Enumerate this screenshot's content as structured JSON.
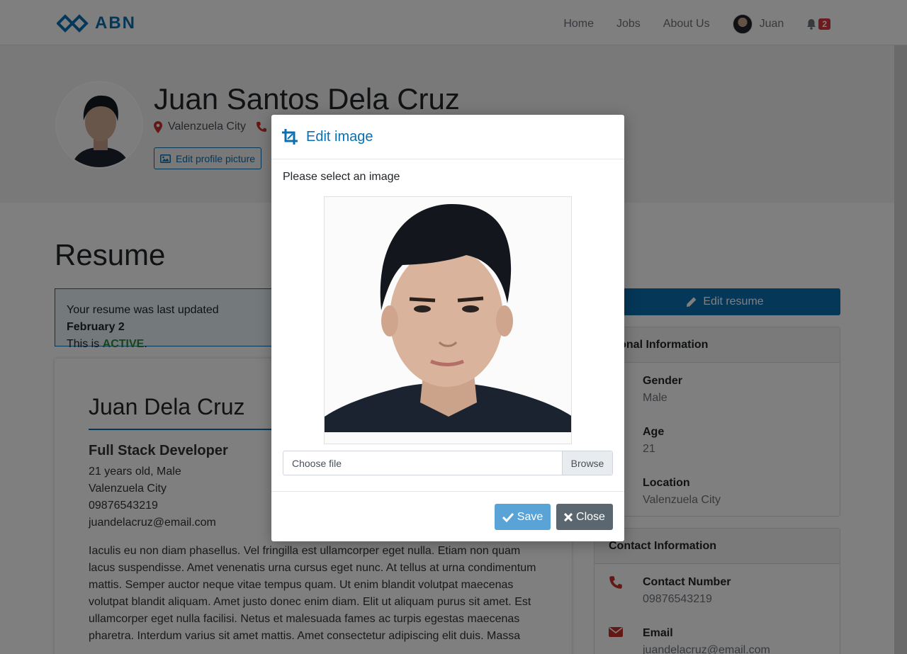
{
  "navbar": {
    "brand": "ABN",
    "links": [
      "Home",
      "Jobs",
      "About Us"
    ],
    "user_name": "Juan",
    "notification_count": "2"
  },
  "profile": {
    "full_name": "Juan Santos Dela Cruz",
    "location": "Valenzuela City",
    "edit_picture_label": "Edit profile picture"
  },
  "resume": {
    "heading": "Resume",
    "status_prefix": "Your resume was last updated ",
    "status_date": "February 2",
    "status_line2_prefix": "This is ",
    "status_active": "ACTIVE",
    "status_line2_suffix": ".",
    "name": "Juan Dela Cruz",
    "role": "Full Stack Developer",
    "details": [
      "21 years old, Male",
      "Valenzuela City",
      "09876543219",
      "juandelacruz@email.com"
    ],
    "bio": "Iaculis eu non diam phasellus. Vel fringilla est ullamcorper eget nulla. Etiam non quam lacus suspendisse. Amet venenatis urna cursus eget nunc. At tellus at urna condimentum mattis. Semper auctor neque vitae tempus quam. Ut enim blandit volutpat maecenas volutpat blandit aliquam. Amet justo donec enim diam. Elit ut aliquam purus sit amet. Est ullamcorper eget nulla facilisi. Netus et malesuada fames ac turpis egestas maecenas pharetra. Interdum varius sit amet mattis. Amet consectetur adipiscing elit duis. Massa"
  },
  "sidebar": {
    "edit_resume_label": "Edit resume",
    "personal": {
      "header": "rsonal Information",
      "rows": [
        {
          "label": "Gender",
          "value": "Male"
        },
        {
          "label": "Age",
          "value": "21"
        },
        {
          "label": "Location",
          "value": "Valenzuela City"
        }
      ]
    },
    "contact": {
      "header": "Contact Information",
      "rows": [
        {
          "label": "Contact Number",
          "value": "09876543219"
        },
        {
          "label": "Email",
          "value": "juandelacruz@email.com"
        }
      ]
    }
  },
  "modal": {
    "title": "Edit image",
    "message": "Please select an image",
    "file_placeholder": "Choose file",
    "browse_label": "Browse",
    "save_label": "Save",
    "close_label": "Close"
  },
  "colors": {
    "brand": "#0a6fb0",
    "active": "#2e8b3e",
    "danger": "#c9302c",
    "save": "#5aa3d6",
    "close": "#5a6770"
  }
}
